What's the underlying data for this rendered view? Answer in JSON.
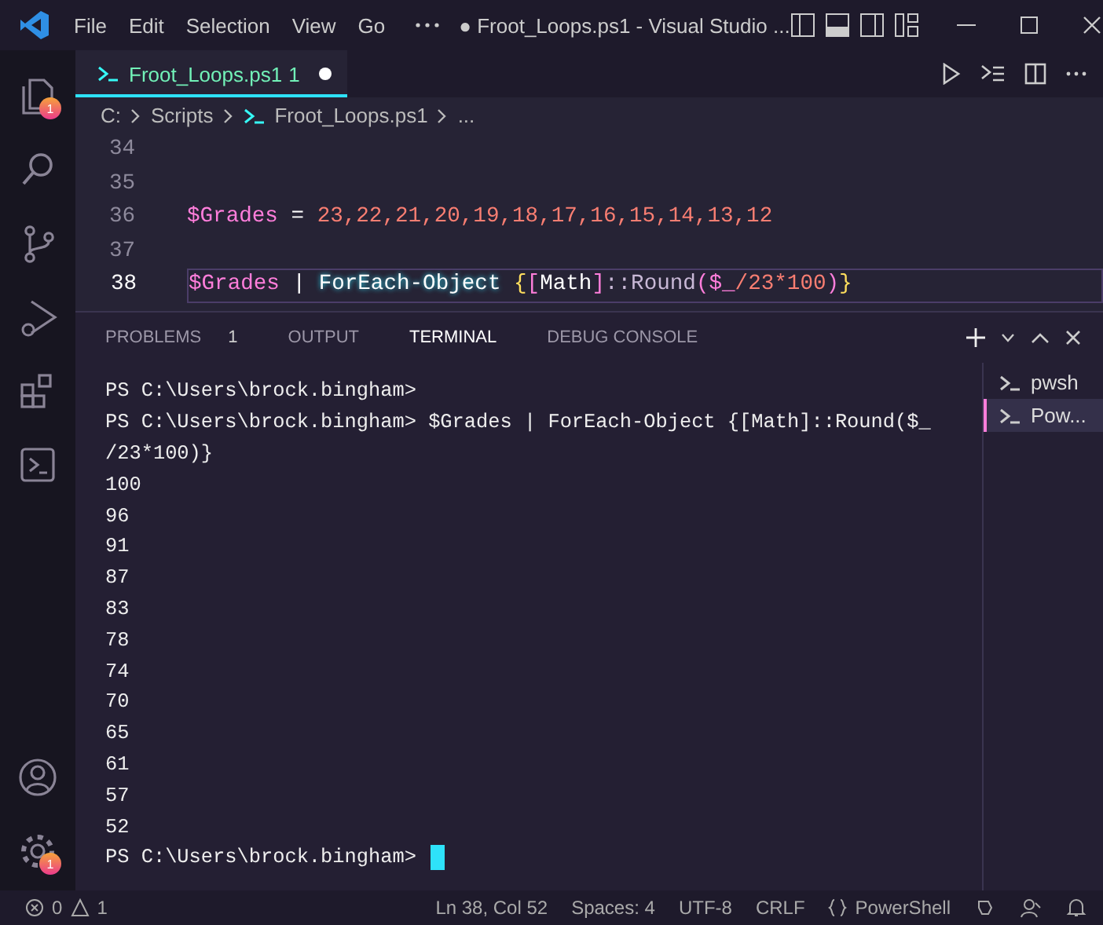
{
  "window": {
    "title": "● Froot_Loops.ps1 - Visual Studio ...",
    "menu": [
      "File",
      "Edit",
      "Selection",
      "View",
      "Go"
    ]
  },
  "activity_bar": {
    "items": [
      {
        "kind": "files",
        "badge": "1"
      },
      {
        "kind": "search"
      },
      {
        "kind": "source-control"
      },
      {
        "kind": "run-debug"
      },
      {
        "kind": "extensions"
      },
      {
        "kind": "terminal"
      }
    ],
    "bottom_items": [
      {
        "kind": "account"
      },
      {
        "kind": "settings",
        "badge": "1"
      }
    ]
  },
  "editor": {
    "tabs": [
      {
        "label": "Froot_Loops.ps1",
        "problems": "1",
        "selected": true,
        "modified": true
      }
    ],
    "breadcrumbs": [
      {
        "label": "C:",
        "kind": "folder"
      },
      {
        "label": "Scripts",
        "kind": "folder"
      },
      {
        "label": "Froot_Loops.ps1",
        "kind": "file"
      },
      {
        "label": "...",
        "kind": "symbol"
      }
    ],
    "lines": [
      {
        "number": "34",
        "current": false
      },
      {
        "number": "35",
        "current": false
      },
      {
        "number": "36",
        "current": false,
        "tokens": [
          {
            "text": "$Grades",
            "kind": "variable"
          },
          {
            "text": " = ",
            "kind": "operator"
          },
          {
            "text": "23,22,21,20,19,18,17,16,15,14,13,12",
            "kind": "number"
          }
        ]
      },
      {
        "number": "37",
        "current": false
      },
      {
        "number": "38",
        "current": true,
        "tokens": [
          {
            "text": "$Grades",
            "kind": "variable"
          },
          {
            "text": " | ",
            "kind": "operator"
          },
          {
            "text": "ForEach-Object",
            "kind": "command"
          },
          {
            "text": " {",
            "kind": "brace"
          },
          {
            "text": "[",
            "kind": "bracket"
          },
          {
            "text": "Math",
            "kind": "type"
          },
          {
            "text": "]",
            "kind": "bracket"
          },
          {
            "text": "::Round",
            "kind": "method"
          },
          {
            "text": "(",
            "kind": "bracket"
          },
          {
            "text": "$_",
            "kind": "variable"
          },
          {
            "text": "/23*100",
            "kind": "number"
          },
          {
            "text": ")",
            "kind": "bracket"
          },
          {
            "text": "}",
            "kind": "brace"
          }
        ]
      }
    ]
  },
  "panel": {
    "tabs": [
      {
        "label": "PROBLEMS",
        "count": "1",
        "selected": false
      },
      {
        "label": "OUTPUT",
        "selected": false
      },
      {
        "label": "TERMINAL",
        "selected": true
      },
      {
        "label": "DEBUG CONSOLE",
        "selected": false
      }
    ],
    "terminal": {
      "lines": [
        {
          "text": "PS C:\\Users\\brock.bingham>",
          "cursor": false
        },
        {
          "text": "PS C:\\Users\\brock.bingham> $Grades | ForEach-Object {[Math]::Round($_",
          "cursor": false
        },
        {
          "text": "/23*100)}",
          "cursor": false
        },
        {
          "text": "100",
          "cursor": false
        },
        {
          "text": "96",
          "cursor": false
        },
        {
          "text": "91",
          "cursor": false
        },
        {
          "text": "87",
          "cursor": false
        },
        {
          "text": "83",
          "cursor": false
        },
        {
          "text": "78",
          "cursor": false
        },
        {
          "text": "74",
          "cursor": false
        },
        {
          "text": "70",
          "cursor": false
        },
        {
          "text": "65",
          "cursor": false
        },
        {
          "text": "61",
          "cursor": false
        },
        {
          "text": "57",
          "cursor": false
        },
        {
          "text": "52",
          "cursor": false
        },
        {
          "text": "PS C:\\Users\\brock.bingham>",
          "cursor": true
        }
      ]
    },
    "sessions": [
      {
        "label": "pwsh",
        "selected": false
      },
      {
        "label": "Pow...",
        "selected": true
      }
    ]
  },
  "status_bar": {
    "errors": "0",
    "warnings": "1",
    "position": "Ln 38, Col 52",
    "indentation": "Spaces: 4",
    "encoding": "UTF-8",
    "line_ending": "CRLF",
    "language": "PowerShell"
  }
}
